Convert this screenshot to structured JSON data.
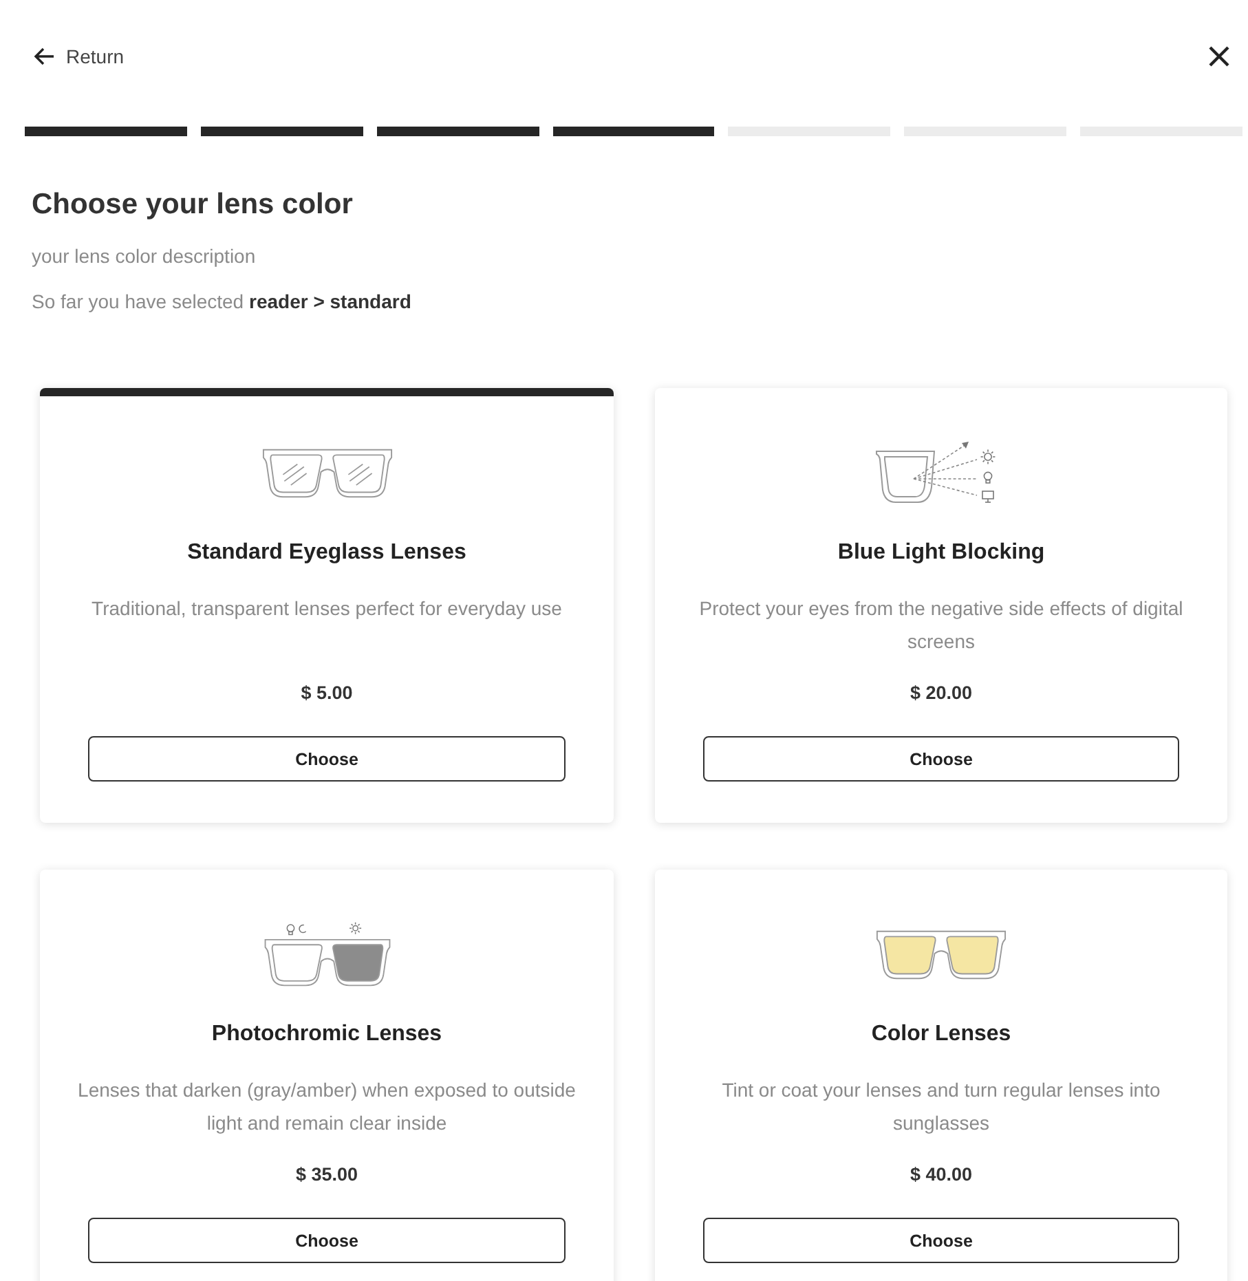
{
  "header": {
    "back_label": "Return"
  },
  "progress": {
    "steps": [
      {
        "completed": true
      },
      {
        "completed": true
      },
      {
        "completed": true
      },
      {
        "completed": true
      },
      {
        "completed": false
      },
      {
        "completed": false
      },
      {
        "completed": false
      }
    ]
  },
  "page": {
    "title": "Choose your lens color",
    "description": "your lens color description",
    "selection_summary": "So far you have selected **reader > standard**"
  },
  "options": [
    {
      "kind": "clear",
      "title": "Standard Eyeglass Lenses",
      "description": "Traditional, transparent lenses perfect for everyday use",
      "price": "$ 5.00",
      "button": "Choose",
      "selected": true
    },
    {
      "kind": "blue-light",
      "title": "Blue Light Blocking",
      "description": "Protect your eyes from the negative side effects of digital screens",
      "price": "$ 20.00",
      "button": "Choose",
      "selected": false
    },
    {
      "kind": "photochromic",
      "title": "Photochromic Lenses",
      "description": "Lenses that darken (gray/amber) when exposed to outside light and remain clear inside",
      "price": "$ 35.00",
      "button": "Choose",
      "selected": false
    },
    {
      "kind": "tinted",
      "title": "Color Lenses",
      "description": "Tint or coat your lenses and turn regular lenses into sunglasses",
      "price": "$ 40.00",
      "button": "Choose",
      "selected": false
    }
  ]
}
